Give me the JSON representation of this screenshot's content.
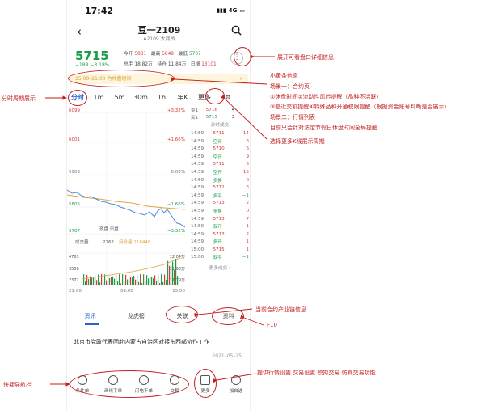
{
  "status": {
    "time": "17:42",
    "signal": "4G"
  },
  "header": {
    "title": "豆一2109",
    "subtitle": "A2109  大商所"
  },
  "quote": {
    "price": "5715",
    "change": "−188  −3.18%",
    "row1": [
      "今开",
      "5831",
      "最高",
      "5848",
      "最低",
      "5707"
    ],
    "row2": [
      "总手",
      "18.82万",
      "持仓",
      "11.84万",
      "日增",
      "13101"
    ]
  },
  "notice": {
    "text": "15:00–21:00 为休盘时间",
    "close": "×"
  },
  "tabs": [
    "分时",
    "1m",
    "5m",
    "30m",
    "1h",
    "年K",
    "更多"
  ],
  "chart": {
    "y_labels": [
      "6099",
      "6001",
      "5903",
      "5805",
      "5707"
    ],
    "pct_labels": [
      "+3.32%",
      "+1.66%",
      "0.00%",
      "−1.66%",
      "−3.32%"
    ],
    "legend": "夜盘  日盘",
    "vol_label": "成交量",
    "vol_value": "2262",
    "hold_label": "持仓量:118448",
    "vol_ticks": [
      "4763",
      "3556",
      "2372"
    ],
    "right_vol": [
      "12.04万",
      "11.93万",
      "11.79万"
    ],
    "times": [
      "21:00",
      "09:00",
      "15:00"
    ]
  },
  "orderbook": {
    "ask": [
      "卖1",
      "5716",
      "4"
    ],
    "bid": [
      "买1",
      "5715",
      "3"
    ],
    "header": "分时成交",
    "rows": [
      [
        "14:59",
        "5711",
        "14"
      ],
      [
        "14:59",
        "空开",
        "6"
      ],
      [
        "14:59",
        "5710",
        "6"
      ],
      [
        "14:59",
        "空开",
        "9"
      ],
      [
        "14:59",
        "5711",
        "5"
      ],
      [
        "14:59",
        "空开",
        "15"
      ],
      [
        "14:59",
        "多换",
        "0"
      ],
      [
        "14:59",
        "5712",
        "6"
      ],
      [
        "14:59",
        "多平",
        "−1"
      ],
      [
        "14:59",
        "5713",
        "2"
      ],
      [
        "14:59",
        "多换",
        "0"
      ],
      [
        "14:59",
        "5713",
        "7"
      ],
      [
        "14:59",
        "双开",
        "1"
      ],
      [
        "14:59",
        "5713",
        "2"
      ],
      [
        "14:59",
        "多开",
        "1"
      ],
      [
        "15:00",
        "5715",
        "1"
      ],
      [
        "15:00",
        "双平",
        "−1"
      ]
    ],
    "more": "更多成交 ›"
  },
  "subtabs": [
    "资讯",
    "龙虎榜",
    "关联",
    "资料"
  ],
  "news": {
    "title": "北京市党政代表团赴内蒙古自治区对接东西部协作工作",
    "date": "2021–05–25"
  },
  "bottom_nav": [
    "条件单",
    "画线下单",
    "闪电下单",
    "交易",
    "更多",
    "加自选"
  ],
  "annotations": {
    "left_period": "分时周期展示",
    "left_nav": "快捷导航栏",
    "expand": "展开可看盘口详细信息",
    "block": [
      "小黄条信息",
      "场景一：合约页",
      "①休盘时间②流动性风险提醒（品种不活跃）",
      "③临近交割提醒④特殊品种开通权限提醒（根据资金账号判断是否展示）",
      "场景二：行情列表",
      "目前只会针对法定节假日休盘时间全局提醒"
    ],
    "kline": "选择更多K线展示周期",
    "chain": "当前合约产业链信息",
    "f10": "F10",
    "features": "提供行情设置 交易设置 模拟交易 仿真交易功能"
  },
  "colors": {
    "up": "#d83a3a",
    "down": "#1a9e4a",
    "accent": "#2a61d6",
    "annotation": "#c41e1e"
  }
}
